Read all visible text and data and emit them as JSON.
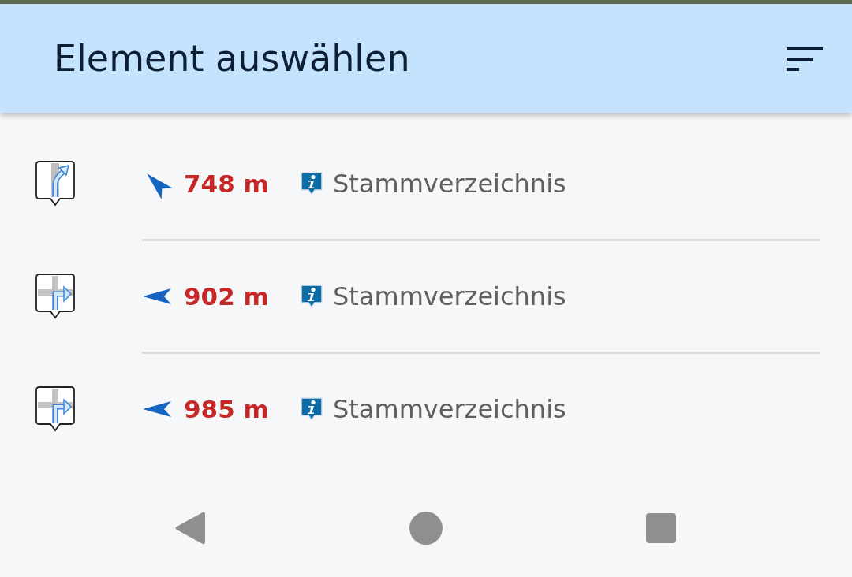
{
  "header": {
    "title": "Element auswählen"
  },
  "items": [
    {
      "kind": "slight_right",
      "arrow": {
        "kind": "northwest"
      },
      "distance": "748 m",
      "source": "Stammverzeichnis"
    },
    {
      "kind": "right",
      "arrow": {
        "kind": "west"
      },
      "distance": "902 m",
      "source": "Stammverzeichnis"
    },
    {
      "kind": "right",
      "arrow": {
        "kind": "west"
      },
      "distance": "985 m",
      "source": "Stammverzeichnis"
    }
  ]
}
